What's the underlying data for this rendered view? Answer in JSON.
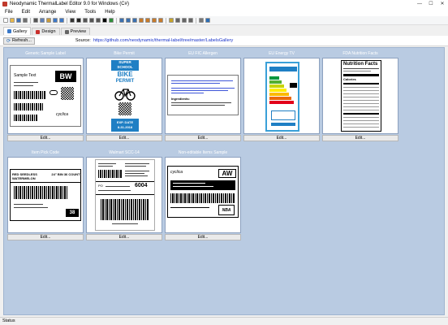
{
  "window": {
    "title": "Neodynamic ThermalLabel Editor 9.0 for Windows (C#)",
    "minimize": "—",
    "maximize": "☐",
    "close": "✕"
  },
  "menu": [
    "File",
    "Edit",
    "Arrange",
    "View",
    "Tools",
    "Help"
  ],
  "toolbar_icons": [
    {
      "name": "new-icon",
      "color": "#ffffff"
    },
    {
      "name": "open-icon",
      "color": "#e8b84a"
    },
    {
      "name": "save-icon",
      "color": "#3f6fb5"
    },
    {
      "name": "print-icon",
      "color": "#6f6f6f"
    },
    {
      "name": "cut-icon",
      "color": "#555555"
    },
    {
      "name": "copy-icon",
      "color": "#5d7fb8"
    },
    {
      "name": "paste-icon",
      "color": "#c89a3b"
    },
    {
      "name": "undo-icon",
      "color": "#3c78c8"
    },
    {
      "name": "redo-icon",
      "color": "#3c78c8"
    },
    {
      "name": "pointer-icon",
      "color": "#333333"
    },
    {
      "name": "text-icon",
      "color": "#222222"
    },
    {
      "name": "rectangle-icon",
      "color": "#555555"
    },
    {
      "name": "ellipse-icon",
      "color": "#555555"
    },
    {
      "name": "line-icon",
      "color": "#555555"
    },
    {
      "name": "barcode-icon",
      "color": "#000000"
    },
    {
      "name": "image-icon",
      "color": "#2f8d3a"
    },
    {
      "name": "align-left-icon",
      "color": "#3a6fb0"
    },
    {
      "name": "align-center-icon",
      "color": "#3a6fb0"
    },
    {
      "name": "align-right-icon",
      "color": "#3a6fb0"
    },
    {
      "name": "group-icon",
      "color": "#c77a2a"
    },
    {
      "name": "ungroup-icon",
      "color": "#c77a2a"
    },
    {
      "name": "bring-front-icon",
      "color": "#c77a2a"
    },
    {
      "name": "send-back-icon",
      "color": "#c77a2a"
    },
    {
      "name": "lock-icon",
      "color": "#c7a42a"
    },
    {
      "name": "zoom-in-icon",
      "color": "#666666"
    },
    {
      "name": "zoom-out-icon",
      "color": "#666666"
    },
    {
      "name": "zoom-fit-icon",
      "color": "#666666"
    },
    {
      "name": "settings-icon",
      "color": "#777777"
    },
    {
      "name": "help-icon",
      "color": "#2a6db6"
    }
  ],
  "tabs": [
    {
      "label": "Gallery",
      "icon": "gallery-icon",
      "color": "#3a78c8"
    },
    {
      "label": "Design",
      "icon": "design-icon",
      "color": "#c9302c"
    },
    {
      "label": "Preview",
      "icon": "preview-icon",
      "color": "#666666"
    }
  ],
  "source": {
    "refresh_label": "Refresh...",
    "label": "Source:",
    "url": "https://github.com/neodynamic/thermal-label/tree/master/LabelsGallery"
  },
  "gallery": {
    "edit_label": "Edit...",
    "cards": [
      {
        "title": "Generic Sample Label"
      },
      {
        "title": "Bike Permit"
      },
      {
        "title": "EU FIC Allergen"
      },
      {
        "title": "EU Energy TV"
      },
      {
        "title": "FDA Nutrition Facts"
      },
      {
        "title": "Item Pick Code"
      },
      {
        "title": "Walmart SCC-14"
      },
      {
        "title": "Non-editable Items Sample"
      }
    ],
    "generic": {
      "sample_text": "Sample Text",
      "bw": "BW",
      "brand": "cyclica"
    },
    "bike": {
      "super": "SUPER",
      "school": "SCHOOL",
      "bike": "BIKE",
      "permit": "PERMIT",
      "exp": "EXP. DATE",
      "date": "8-31-2018"
    },
    "allergen": {
      "ingredients": "Ingredients:"
    },
    "nutrition": {
      "title": "Nutrition Facts",
      "calories": "Calories"
    },
    "pick": {
      "name": "RED SEEDLESS WATERMELON",
      "size": "24\" BIN 36 COUNT",
      "count": "38"
    },
    "walmart": {
      "po": "PO",
      "num": "6004"
    },
    "noneditable": {
      "aw": "AW",
      "brand": "cyclica",
      "logo": "NBA"
    }
  },
  "status": "Status"
}
